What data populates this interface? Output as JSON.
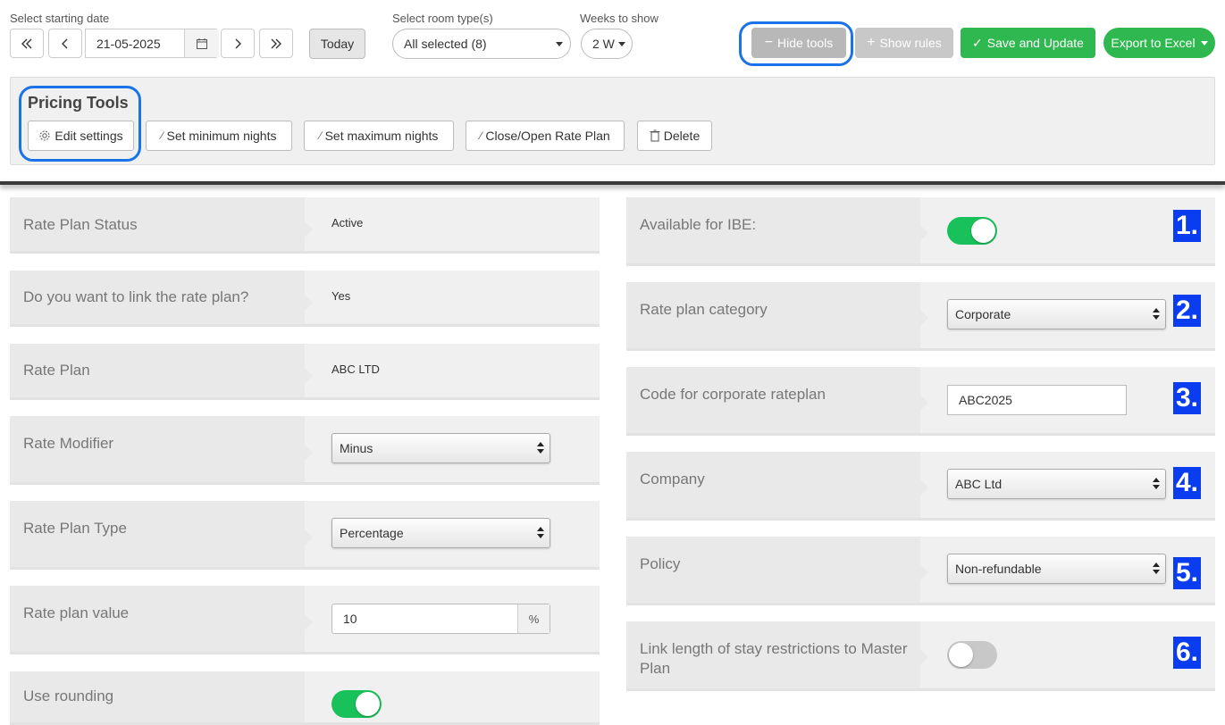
{
  "header": {
    "date_label": "Select starting date",
    "date_value": "21-05-2025",
    "today_label": "Today",
    "room_label": "Select room type(s)",
    "room_value": "All selected (8)",
    "weeks_label": "Weeks to show",
    "weeks_value": "2 W",
    "hide_tools": "Hide tools",
    "show_rules": "Show rules",
    "save_update": "Save and Update",
    "export": "Export to Excel"
  },
  "tools": {
    "title": "Pricing Tools",
    "buttons": [
      "Edit settings",
      "Set minimum nights",
      "Set maximum nights",
      "Close/Open Rate Plan",
      "Delete"
    ]
  },
  "left_fields": [
    {
      "label": "Rate Plan Status",
      "value": "Active"
    },
    {
      "label": "Do you want to link the rate plan?",
      "value": "Yes"
    },
    {
      "label": "Rate Plan",
      "value": "ABC LTD"
    },
    {
      "label": "Rate Modifier",
      "value": "Minus"
    },
    {
      "label": "Rate Plan Type",
      "value": "Percentage"
    },
    {
      "label": "Rate plan value",
      "value": "10",
      "unit": "%"
    },
    {
      "label": "Use rounding",
      "value": ""
    }
  ],
  "right_fields": [
    {
      "label": "Available for IBE:",
      "badge": "1.",
      "toggle_on": true
    },
    {
      "label": "Rate plan category",
      "value": "Corporate",
      "badge": "2."
    },
    {
      "label": "Code for corporate rateplan",
      "value": "ABC2025",
      "badge": "3."
    },
    {
      "label": "Company",
      "value": "ABC Ltd",
      "badge": "4."
    },
    {
      "label": "Policy",
      "value": "Non-refundable",
      "badge": "5."
    },
    {
      "label": "Link length of stay restrictions to Master Plan",
      "badge": "6.",
      "toggle_on": false
    }
  ],
  "colors": {
    "accent_green": "#2eb84f",
    "highlight_ring": "#1a73e8",
    "badge_blue": "#0a3cf0",
    "toggle_on": "#19c15a"
  }
}
